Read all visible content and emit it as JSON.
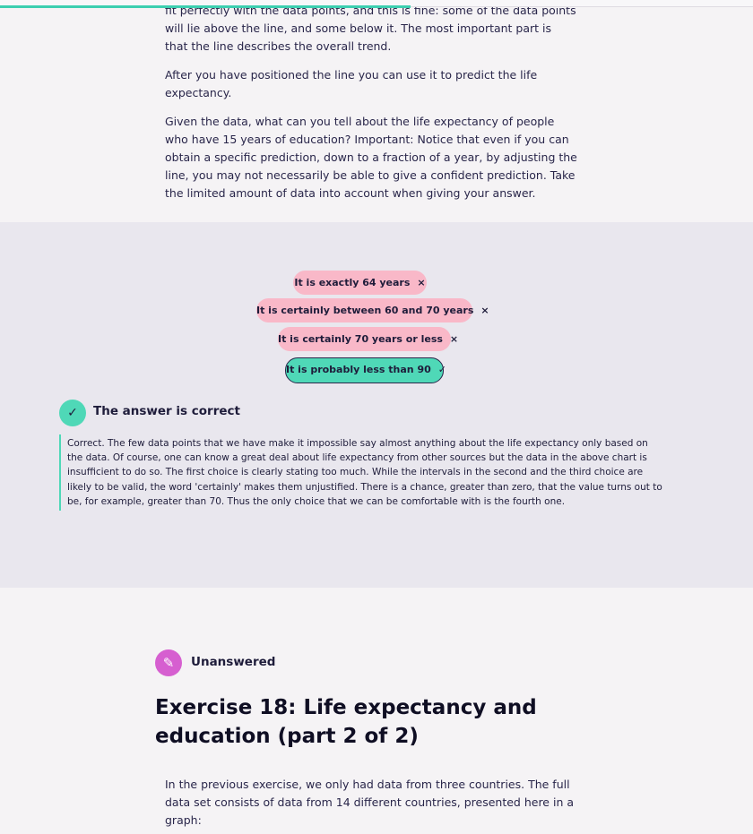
{
  "progress": {
    "fraction": 0.545
  },
  "intro": {
    "p1": "fit perfectly with the data points, and this is fine: some of the data points will lie above the line, and some below it. The most important part is that the line describes the overall trend.",
    "p2": "After you have positioned the line you can use it to predict the life expectancy.",
    "p3": "Given the data, what can you tell about the life expectancy of people who have 15 years of education? Important: Notice that even if you can obtain a specific prediction, down to a fraction of a year, by adjusting the line, you may not necessarily be able to give a confident prediction. Take the limited amount of data into account when giving your answer."
  },
  "quiz": {
    "options": [
      {
        "label": "It is exactly 64 years",
        "state": "wrong",
        "mark": "×"
      },
      {
        "label": "It is certainly between 60 and 70 years",
        "state": "wrong",
        "mark": "×"
      },
      {
        "label": "It is certainly 70 years or less",
        "state": "wrong",
        "mark": "×"
      },
      {
        "label": "It is probably less than 90",
        "state": "correct",
        "mark": "✓"
      }
    ],
    "verdict": "The answer is correct",
    "explanation": "Correct. The few data points that we have make it impossible say almost anything about the life expectancy only based on the data. Of course, one can know a great deal about life expectancy from other sources but the data in the above chart is insufficient to do so. The first choice is clearly stating too much. While the intervals in the second and the third choice are likely to be valid, the word 'certainly' makes them unjustified. There is a chance, greater than zero, that the value turns out to be, for example, greater than 70. Thus the only choice that we can be comfortable with is the fourth one."
  },
  "next_exercise": {
    "status": "Unanswered",
    "status_icon": "pencil-icon",
    "title": "Exercise 18: Life expectancy and education (part 2 of 2)",
    "body": "In the previous exercise, we only had data from three countries. The full data set consists of data from 14 different countries, presented here in a graph:"
  },
  "colors": {
    "correct": "#4fd8b7",
    "wrong": "#f9b8c8",
    "unanswered": "#d65fd0",
    "progress": "#3ccfb0"
  }
}
